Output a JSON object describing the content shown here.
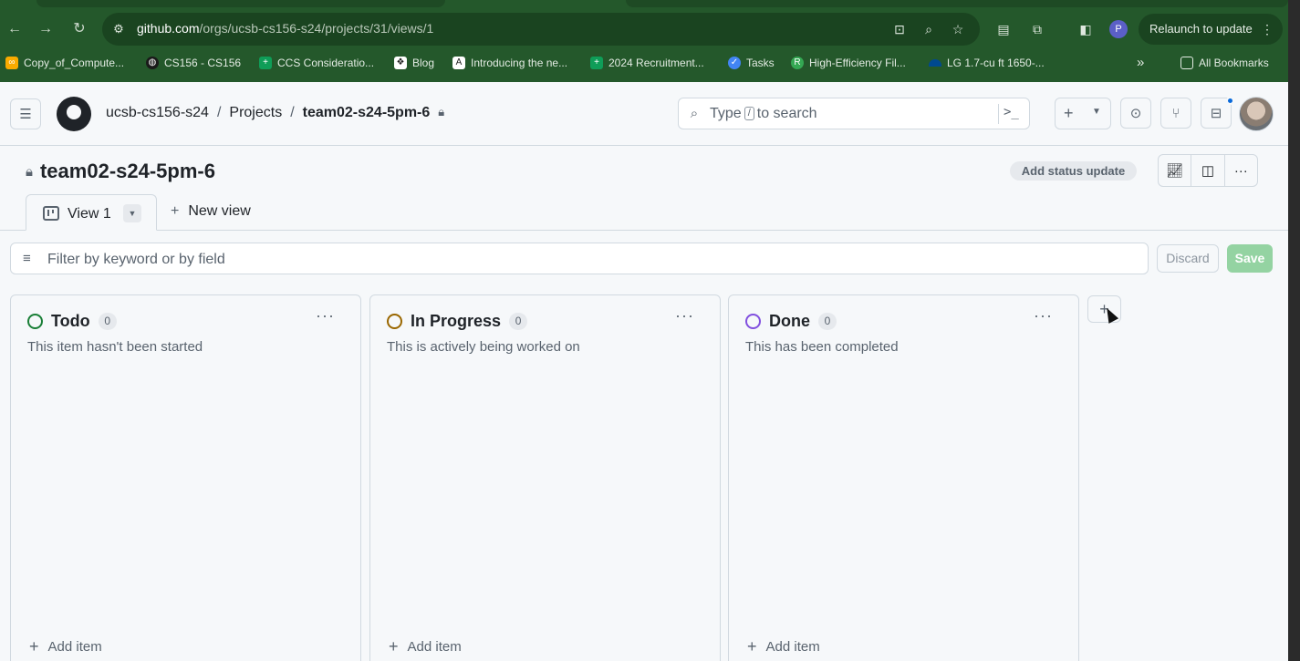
{
  "browser": {
    "url_host": "github.com",
    "url_path": "/orgs/ucsb-cs156-s24/projects/31/views/1",
    "relaunch_label": "Relaunch to update",
    "profile_initial": "P",
    "bookmarks": [
      {
        "label": "Copy_of_Compute...",
        "icon": "colab-icon",
        "color": "#f9ab00"
      },
      {
        "label": "CS156 - CS156",
        "icon": "globe-icon",
        "color": "#2f6f3a"
      },
      {
        "label": "CCS Consideratio...",
        "icon": "sheets-icon",
        "color": "#0f9d58"
      },
      {
        "label": "Blog",
        "icon": "dropbox-icon",
        "color": "#3d3d3d"
      },
      {
        "label": "Introducing the ne...",
        "icon": "anthropic-icon",
        "color": "#3d3d3d"
      },
      {
        "label": "2024 Recruitment...",
        "icon": "sheets-icon",
        "color": "#0f9d58"
      },
      {
        "label": "Tasks",
        "icon": "tasks-icon",
        "color": "#4285f4"
      },
      {
        "label": "High-Efficiency Fil...",
        "icon": "leaf-icon",
        "color": "#34a853"
      },
      {
        "label": "LG 1.7-cu ft 1650-...",
        "icon": "lowes-icon",
        "color": "#004990"
      }
    ],
    "all_bookmarks_label": "All Bookmarks"
  },
  "header": {
    "crumbs": {
      "org": "ucsb-cs156-s24",
      "sep": "/",
      "projects": "Projects",
      "project": "team02-s24-5pm-6"
    },
    "search": {
      "prefix": "Type",
      "key": "/",
      "suffix": "to search"
    }
  },
  "project": {
    "title": "team02-s24-5pm-6",
    "status_update_label": "Add status update"
  },
  "views": {
    "active_label": "View 1",
    "new_view_label": "New view"
  },
  "filter": {
    "placeholder": "Filter by keyword or by field",
    "discard_label": "Discard",
    "save_label": "Save"
  },
  "columns": [
    {
      "name": "Todo",
      "count": "0",
      "description": "This item hasn't been started",
      "color": "#1a7f37",
      "add_label": "Add item"
    },
    {
      "name": "In Progress",
      "count": "0",
      "description": "This is actively being worked on",
      "color": "#9a6700",
      "add_label": "Add item"
    },
    {
      "name": "Done",
      "count": "0",
      "description": "This has been completed",
      "color": "#8250df",
      "add_label": "Add item"
    }
  ]
}
